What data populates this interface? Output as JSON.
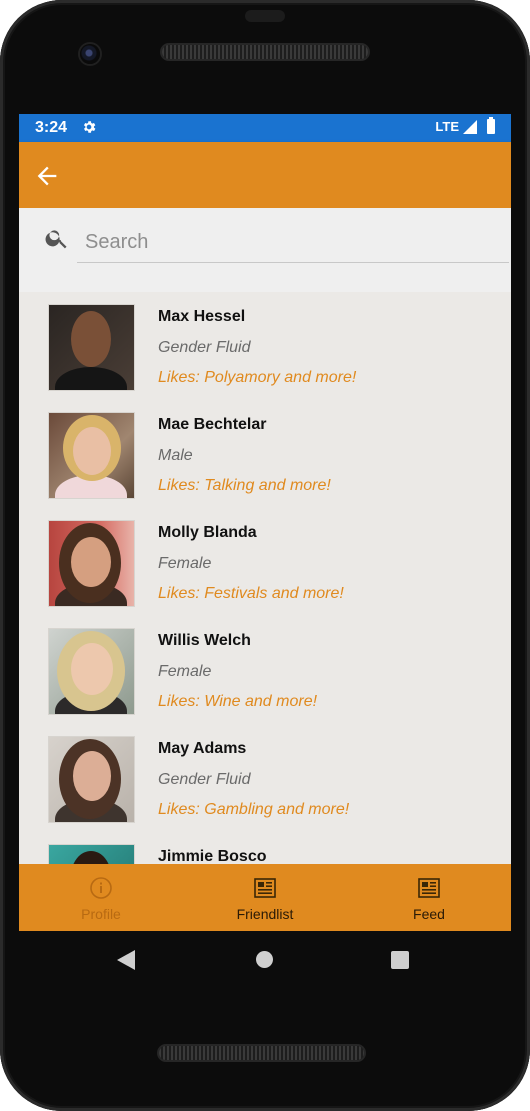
{
  "status_bar": {
    "time": "3:24",
    "network": "LTE"
  },
  "search": {
    "placeholder": "Search"
  },
  "people": [
    {
      "name": "Max Hessel",
      "gender": "Gender Fluid",
      "likes": "Likes: Polyamory and more!"
    },
    {
      "name": "Mae Bechtelar",
      "gender": "Male",
      "likes": "Likes: Talking and more!"
    },
    {
      "name": "Molly Blanda",
      "gender": "Female",
      "likes": "Likes: Festivals and more!"
    },
    {
      "name": "Willis Welch",
      "gender": "Female",
      "likes": "Likes: Wine and more!"
    },
    {
      "name": "May Adams",
      "gender": "Gender Fluid",
      "likes": "Likes: Gambling and more!"
    },
    {
      "name": "Jimmie Bosco",
      "gender": "",
      "likes": ""
    }
  ],
  "bottom_nav": [
    {
      "label": "Profile",
      "icon": "info-circle-icon",
      "active": false
    },
    {
      "label": "Friendlist",
      "icon": "newspaper-icon",
      "active": true
    },
    {
      "label": "Feed",
      "icon": "newspaper-icon",
      "active": true
    }
  ],
  "colors": {
    "app_bar": "#e08a1f",
    "status_bar": "#1a73d0",
    "accent_text": "#e08a1f",
    "list_background": "#ebe9e6"
  }
}
